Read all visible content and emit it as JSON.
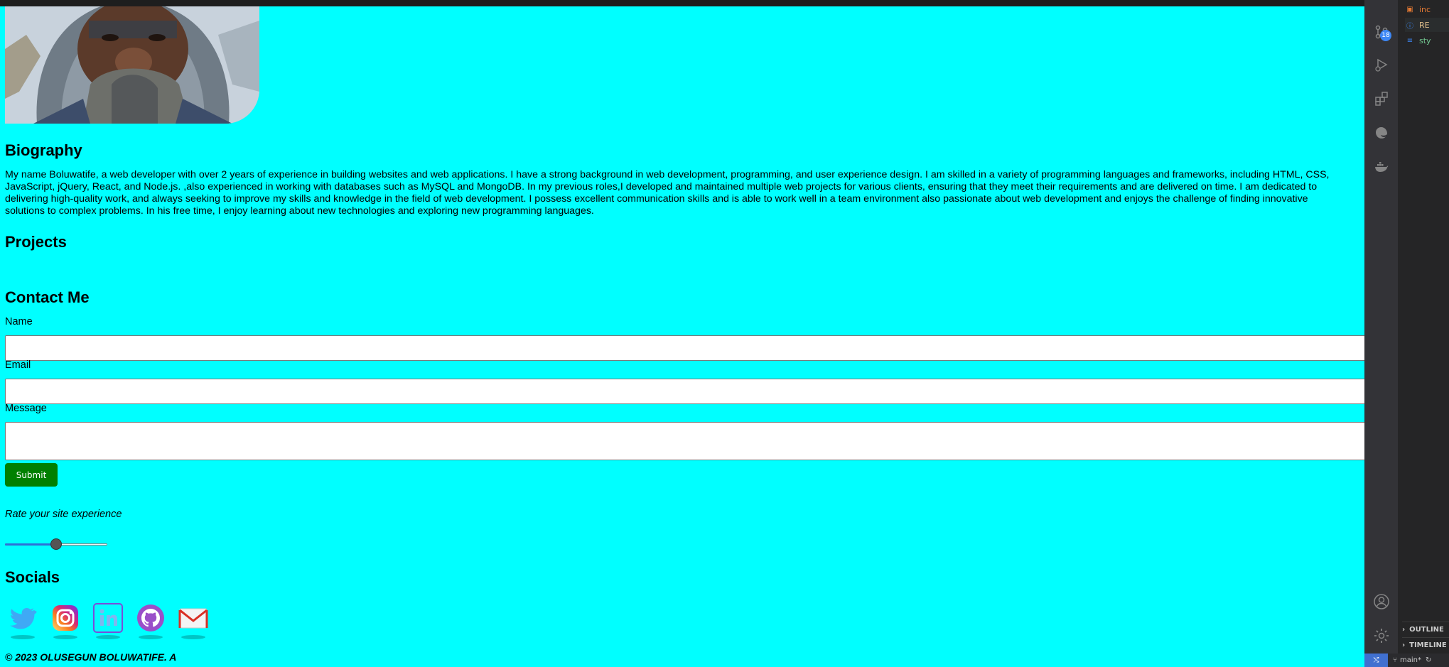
{
  "biography": {
    "heading": "Biography",
    "text": "My name Boluwatife, a web developer with over 2 years of experience in building websites and web applications. I have a strong background in web development, programming, and user experience design. I am skilled in a variety of programming languages and frameworks, including HTML, CSS, JavaScript, jQuery, React, and Node.js. ,also experienced in working with databases such as MySQL and MongoDB. In my previous roles,I developed and maintained multiple web projects for various clients, ensuring that they meet their requirements and are delivered on time. I am dedicated to delivering high-quality work, and always seeking to improve my skills and knowledge in the field of web development. I possess excellent communication skills and is able to work well in a team environment also passionate about web development and enjoys the challenge of finding innovative solutions to complex problems. In his free time, I enjoy learning about new technologies and exploring new programming languages."
  },
  "projects": {
    "heading": "Projects"
  },
  "contact": {
    "heading": "Contact Me",
    "name_label": "Name",
    "name_value": "",
    "email_label": "Email",
    "email_value": "",
    "message_label": "Message",
    "message_value": "",
    "submit_label": "Submit"
  },
  "rating": {
    "label": "Rate your site experience",
    "value": 0.5
  },
  "socials": {
    "heading": "Socials",
    "icons": [
      "twitter-icon",
      "instagram-icon",
      "linkedin-icon",
      "github-icon",
      "mail-icon"
    ]
  },
  "footer": {
    "copyright": "© 2023 OLUSEGUN BOLUWATIFE. A"
  },
  "colors": {
    "page_background": "#00ffff",
    "submit_button": "#008000",
    "slider_fill": "#2f6fd6"
  },
  "vscode": {
    "source_control_badge": "18",
    "explorer_files": [
      {
        "name": "inc",
        "icon": "html-file-icon",
        "color": "#e37933"
      },
      {
        "name": "RE",
        "icon": "info-file-icon",
        "color": "#e2c08d"
      },
      {
        "name": "sty",
        "icon": "css-file-icon",
        "color": "#73c991"
      }
    ],
    "panels": [
      "OUTLINE",
      "TIMELINE"
    ],
    "branch": "main*"
  }
}
